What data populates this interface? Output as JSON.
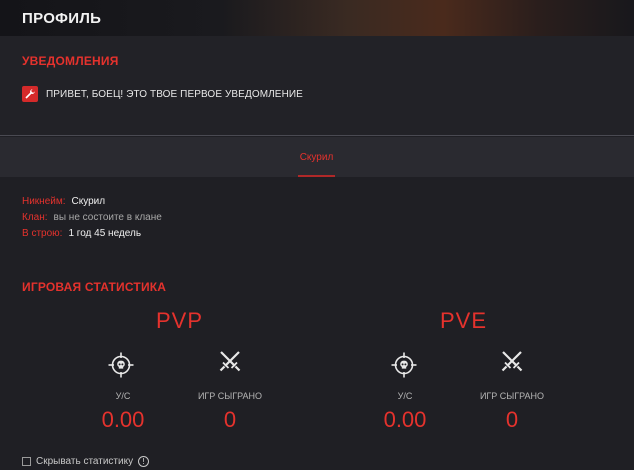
{
  "header": {
    "title": "ПРОФИЛЬ"
  },
  "notifications": {
    "title": "УВЕДОМЛЕНИЯ",
    "items": [
      {
        "icon": "wrench-icon",
        "text": "ПРИВЕТ, БОЕЦ! ЭТО ТВОЕ ПЕРВОЕ УВЕДОМЛЕНИЕ"
      }
    ]
  },
  "tabs": [
    {
      "label": "Скурил",
      "active": true
    }
  ],
  "profile": {
    "nickname": {
      "label": "Никнейм:",
      "value": "Скурил"
    },
    "clan": {
      "label": "Клан:",
      "value": "вы не состоите в клане"
    },
    "service": {
      "label": "В строю:",
      "value": "1 год 45 недель"
    }
  },
  "stats": {
    "title": "ИГРОВАЯ СТАТИСТИКА",
    "pvp": {
      "label": "PVP",
      "kd": {
        "icon": "crosshair-skull-icon",
        "label": "У/С",
        "value": "0.00"
      },
      "games": {
        "icon": "crossed-swords-icon",
        "label": "ИГР СЫГРАНО",
        "value": "0"
      }
    },
    "pve": {
      "label": "PVE",
      "kd": {
        "icon": "crosshair-skull-icon",
        "label": "У/С",
        "value": "0.00"
      },
      "games": {
        "icon": "crossed-swords-icon",
        "label": "ИГР СЫГРАНО",
        "value": "0"
      }
    }
  },
  "footer": {
    "hide_stats_label": "Скрывать статистику",
    "hide_stats_checked": false
  },
  "colors": {
    "accent": "#e5322d",
    "background": "#1f1f24",
    "panel": "#222227",
    "tabbar": "#2a2a30"
  }
}
